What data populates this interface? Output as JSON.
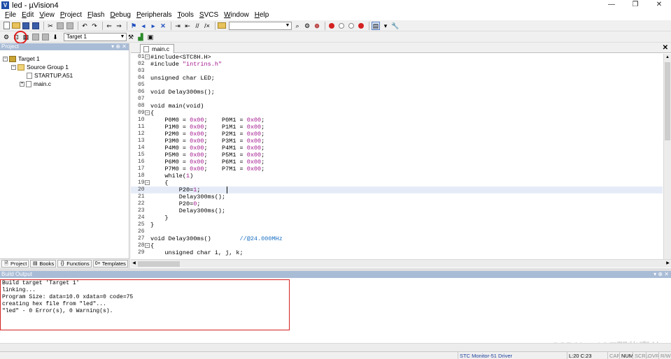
{
  "window": {
    "title": "led  - µVision4",
    "controls": {
      "minimize": "—",
      "restore": "❐",
      "close": "✕"
    }
  },
  "menu": {
    "items": [
      {
        "label": "File",
        "ul": "F",
        "rest": "ile"
      },
      {
        "label": "Edit",
        "ul": "E",
        "rest": "dit"
      },
      {
        "label": "View",
        "ul": "V",
        "rest": "iew"
      },
      {
        "label": "Project",
        "ul": "P",
        "rest": "roject"
      },
      {
        "label": "Flash",
        "ul": "F",
        "rest": "lash",
        "pre": ""
      },
      {
        "label": "Debug",
        "ul": "D",
        "rest": "ebug"
      },
      {
        "label": "Peripherals",
        "ul": "P",
        "rest": "eripherals"
      },
      {
        "label": "Tools",
        "ul": "T",
        "rest": "ools"
      },
      {
        "label": "SVCS",
        "ul": "S",
        "rest": "VCS"
      },
      {
        "label": "Window",
        "ul": "W",
        "rest": "indow"
      },
      {
        "label": "Help",
        "ul": "H",
        "rest": "elp"
      }
    ]
  },
  "toolbar2": {
    "target_value": "Target 1"
  },
  "project_pane": {
    "header": "Project",
    "header_buttons": "▾ ⊕ ✕",
    "tree": {
      "target": "Target 1",
      "group": "Source Group 1",
      "files": [
        "STARTUP.A51",
        "main.c"
      ]
    },
    "tabs": [
      {
        "icon": "🗎",
        "label": "Project"
      },
      {
        "icon": "▤",
        "label": "Books"
      },
      {
        "icon": "{}",
        "label": "Functions"
      },
      {
        "icon": "0+",
        "label": "Templates"
      }
    ]
  },
  "editor": {
    "tab_label": "main.c",
    "close_label": "✕",
    "lines": [
      {
        "n": "01",
        "fold": "⊟",
        "html": "#include<STC8H.H>",
        "type": "pp"
      },
      {
        "n": "02",
        "html": "#include \"intrins.h\"",
        "type": "pp"
      },
      {
        "n": "03",
        "html": ""
      },
      {
        "n": "04",
        "html": "unsigned char LED;"
      },
      {
        "n": "05",
        "html": ""
      },
      {
        "n": "06",
        "html": "void Delay300ms();"
      },
      {
        "n": "07",
        "html": ""
      },
      {
        "n": "08",
        "html": "void main(void)"
      },
      {
        "n": "09",
        "fold": "⊟",
        "html": "{"
      },
      {
        "n": "10",
        "html": "    P0M0 = 0x00;    P0M1 = 0x00;"
      },
      {
        "n": "11",
        "html": "    P1M0 = 0x00;    P1M1 = 0x00;"
      },
      {
        "n": "12",
        "html": "    P2M0 = 0x00;    P2M1 = 0x00;"
      },
      {
        "n": "13",
        "html": "    P3M0 = 0x00;    P3M1 = 0x00;"
      },
      {
        "n": "14",
        "html": "    P4M0 = 0x00;    P4M1 = 0x00;"
      },
      {
        "n": "15",
        "html": "    P5M0 = 0x00;    P5M1 = 0x00;"
      },
      {
        "n": "16",
        "html": "    P6M0 = 0x00;    P6M1 = 0x00;"
      },
      {
        "n": "17",
        "html": "    P7M0 = 0x00;    P7M1 = 0x00;"
      },
      {
        "n": "18",
        "html": "    while(1)"
      },
      {
        "n": "19",
        "fold": "⊟",
        "html": "    {"
      },
      {
        "n": "20",
        "html": "        P20=1;",
        "current": true
      },
      {
        "n": "21",
        "html": "        Delay300ms();"
      },
      {
        "n": "22",
        "html": "        P20=0;"
      },
      {
        "n": "23",
        "html": "        Delay300ms();"
      },
      {
        "n": "24",
        "html": "    }"
      },
      {
        "n": "25",
        "html": "}"
      },
      {
        "n": "26",
        "html": ""
      },
      {
        "n": "27",
        "html": "void Delay300ms()        //@24.000MHz"
      },
      {
        "n": "28",
        "fold": "⊟",
        "html": "{"
      },
      {
        "n": "29",
        "html": "    unsigned char i, j, k;"
      }
    ]
  },
  "build_output": {
    "header": "Build Output",
    "header_buttons": "▾ ⊕ ✕",
    "lines": [
      "Build target 'Target 1'",
      "linking...",
      "Program Size: data=10.0 xdata=0 code=75",
      "creating hex file from \"led\"...",
      "\"led\" - 0 Error(s), 0 Warning(s)."
    ],
    "watermark": "CSDN @IOT那些事儿"
  },
  "statusbar": {
    "driver": "STC Monitor-51 Driver",
    "position": "L:20 C:23",
    "cap": "CAP",
    "num": "NUM",
    "scrl": "SCRL",
    "ovr": "OVR",
    "rw": "R/W"
  }
}
